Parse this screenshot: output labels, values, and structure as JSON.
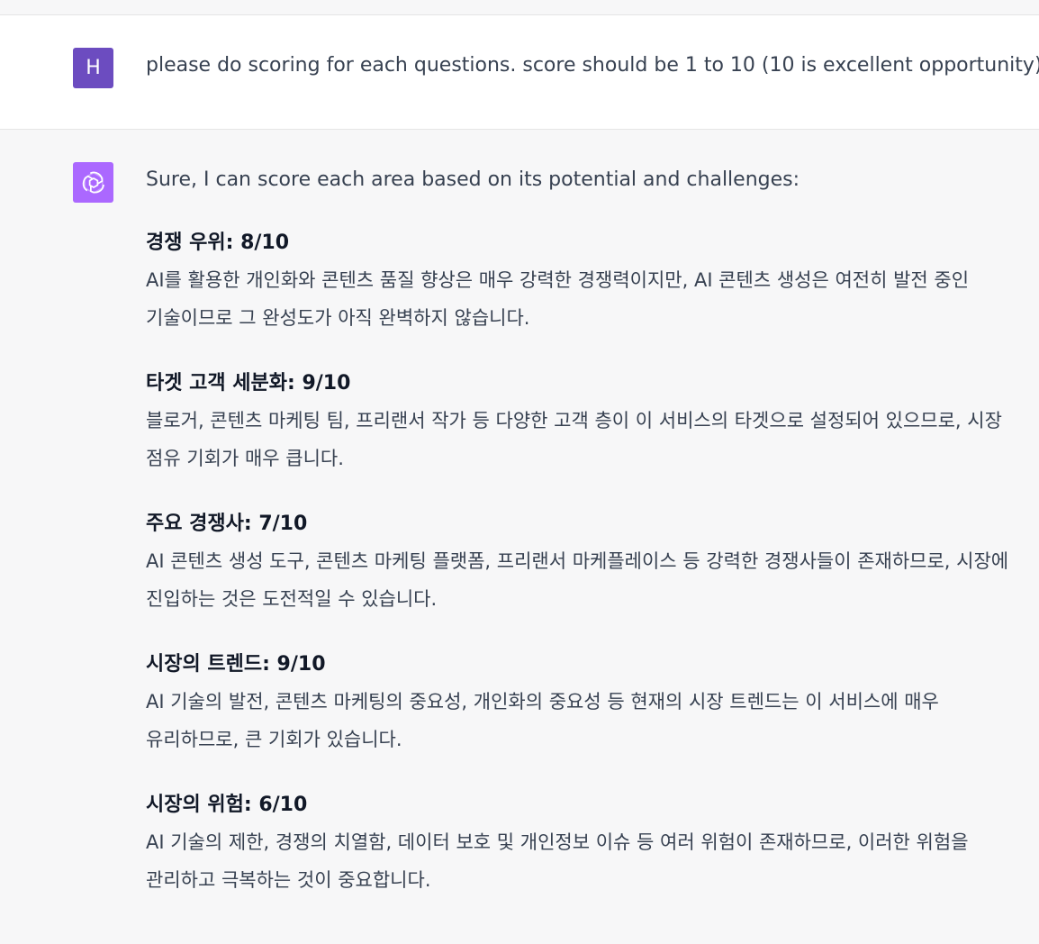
{
  "user_message": {
    "avatar_letter": "H",
    "text": "please do scoring for each questions. score should be  1 to 10 (10 is excellent opportunity)"
  },
  "assistant_message": {
    "avatar_icon": "openai-logo-icon",
    "intro": "Sure, I can score each area based on its potential and challenges:",
    "sections": [
      {
        "title": "경쟁 우위: 8/10",
        "body": "AI를 활용한 개인화와 콘텐츠 품질 향상은 매우 강력한 경쟁력이지만, AI 콘텐츠 생성은 여전히 발전 중인 기술이므로 그 완성도가 아직 완벽하지 않습니다."
      },
      {
        "title": "타겟 고객 세분화: 9/10",
        "body": "블로거, 콘텐츠 마케팅 팀, 프리랜서 작가 등 다양한 고객 층이 이 서비스의 타겟으로 설정되어 있으므로, 시장 점유 기회가 매우 큽니다."
      },
      {
        "title": "주요 경쟁사: 7/10",
        "body": "AI 콘텐츠 생성 도구, 콘텐츠 마케팅 플랫폼, 프리랜서 마케플레이스 등 강력한 경쟁사들이 존재하므로, 시장에 진입하는 것은 도전적일 수 있습니다."
      },
      {
        "title": "시장의 트렌드: 9/10",
        "body": "AI 기술의 발전, 콘텐츠 마케팅의 중요성, 개인화의 중요성 등 현재의 시장 트렌드는 이 서비스에 매우 유리하므로, 큰 기회가 있습니다."
      },
      {
        "title": "시장의 위험: 6/10",
        "body": "AI 기술의 제한, 경쟁의 치열함, 데이터 보호 및 개인정보 이슈 등 여러 위험이 존재하므로, 이러한 위험을 관리하고 극복하는 것이 중요합니다."
      }
    ]
  },
  "colors": {
    "user_avatar": "#6c4cc0",
    "assistant_avatar": "#ab68ff",
    "user_bg": "#ffffff",
    "assistant_bg": "#f7f7f8"
  }
}
